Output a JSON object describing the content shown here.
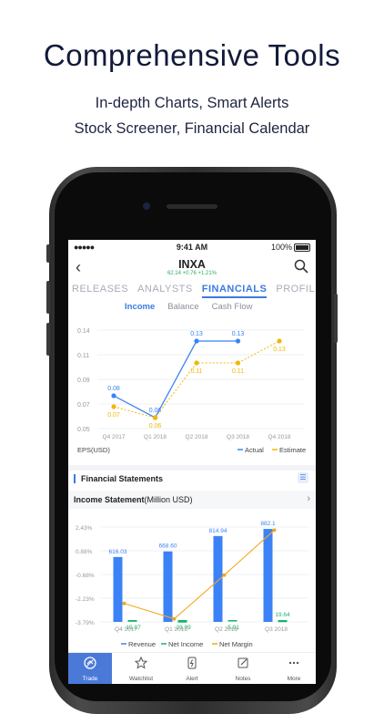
{
  "headline": {
    "title": "Comprehensive Tools",
    "line1": "In-depth Charts, Smart Alerts",
    "line2": "Stock Screener, Financial Calendar"
  },
  "status_bar": {
    "signal": "●●●●●",
    "time": "9:41 AM",
    "battery": "100%"
  },
  "header": {
    "ticker": "INXA",
    "quote": "62.14 +0.76 +1.21%"
  },
  "tabs": [
    {
      "label": "RELEASES",
      "active": false
    },
    {
      "label": "ANALYSTS",
      "active": false
    },
    {
      "label": "FINANCIALS",
      "active": true
    },
    {
      "label": "PROFILE",
      "active": false
    }
  ],
  "subtabs": [
    {
      "label": "Income",
      "active": true
    },
    {
      "label": "Balance",
      "active": false
    },
    {
      "label": "Cash Flow",
      "active": false
    }
  ],
  "eps_chart": {
    "ylabel": "EPS(USD)",
    "yticks": [
      "0.14",
      "0.11",
      "0.09",
      "0.07",
      "0.05"
    ],
    "legend": [
      "Actual",
      "Estimate"
    ],
    "colors": {
      "actual": "#3b82f6",
      "estimate": "#f2b705"
    }
  },
  "financial_statements": {
    "title": "Financial Statements",
    "row_label": "Income Statement",
    "row_unit": "(Million  USD)"
  },
  "rev_chart": {
    "yticks": [
      "2.43%",
      "0.88%",
      "-0.68%",
      "-2.23%",
      "-3.79%"
    ],
    "legend": [
      "Revenue",
      "Net Income",
      "Net Margin"
    ],
    "colors": {
      "revenue": "#3b82f6",
      "net_income": "#1bb36a",
      "margin": "#f2a91a"
    }
  },
  "bottom_nav": [
    {
      "label": "Trade",
      "icon": "trade-icon",
      "active": true
    },
    {
      "label": "Watchlist",
      "icon": "star-icon",
      "active": false
    },
    {
      "label": "Alert",
      "icon": "alert-icon",
      "active": false
    },
    {
      "label": "Notes",
      "icon": "notes-icon",
      "active": false
    },
    {
      "label": "More",
      "icon": "more-icon",
      "active": false
    }
  ],
  "chart_data": [
    {
      "type": "line",
      "title": "",
      "xlabel": "",
      "ylabel": "EPS(USD)",
      "categories": [
        "Q4 2017",
        "Q1 2018",
        "Q2 2018",
        "Q3 2018",
        "Q4 2018"
      ],
      "series": [
        {
          "name": "Actual",
          "values": [
            0.08,
            0.06,
            0.13,
            0.13,
            null
          ]
        },
        {
          "name": "Estimate",
          "values": [
            0.07,
            0.06,
            0.11,
            0.11,
            0.13
          ]
        }
      ],
      "ylim": [
        0.05,
        0.14
      ],
      "legend": "bottom-right",
      "grid": true
    },
    {
      "type": "bar",
      "title": "",
      "xlabel": "",
      "ylabel": "",
      "categories": [
        "Q4 2017",
        "Q1 2018",
        "Q2 2018",
        "Q3 2018"
      ],
      "series": [
        {
          "name": "Revenue",
          "values": [
            616.03,
            668.6,
            814.94,
            882.1
          ]
        },
        {
          "name": "Net Income",
          "values": [
            -15.87,
            -23.99,
            -5.91,
            19.64
          ]
        },
        {
          "name": "Net Margin",
          "values": [
            -2.58,
            -3.59,
            -0.72,
            2.23
          ]
        }
      ],
      "ylim_margin": [
        -3.79,
        2.43
      ],
      "legend": "bottom",
      "grid": true
    }
  ]
}
